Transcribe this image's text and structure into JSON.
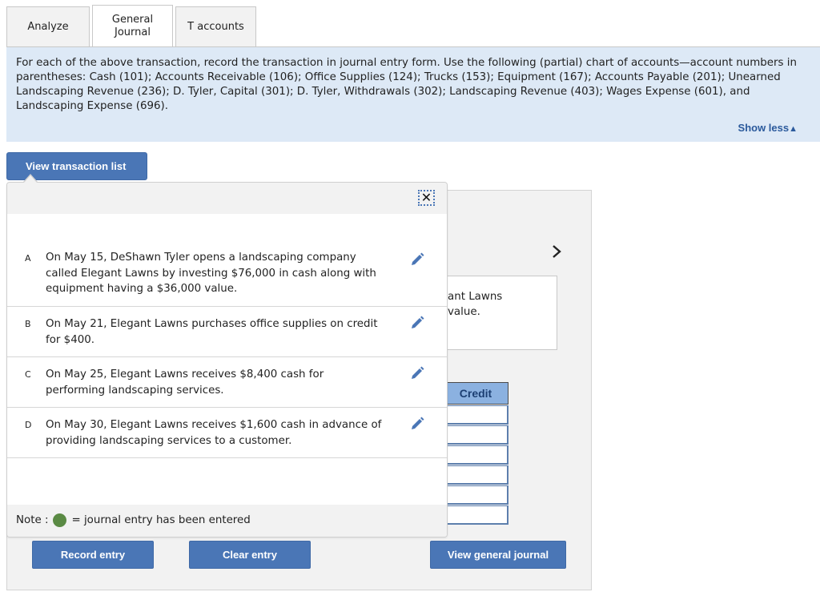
{
  "tabs": [
    {
      "label": "Analyze",
      "active": false
    },
    {
      "label_line1": "General",
      "label_line2": "Journal",
      "active": true
    },
    {
      "label": "T accounts",
      "active": false
    }
  ],
  "instructions": {
    "text": "For each of the above transaction, record the transaction in journal entry form. Use the following (partial) chart of accounts—account numbers in parentheses: Cash (101); Accounts Receivable (106); Office Supplies (124); Trucks (153); Equipment (167); Accounts Payable (201); Unearned Landscaping Revenue (236); D. Tyler, Capital (301); D. Tyler, Withdrawals (302); Landscaping Revenue (403); Wages Expense (601), and Landscaping Expense (696).",
    "toggle_label": "Show less",
    "toggle_icon": "triangle-up"
  },
  "view_transaction_list_label": "View transaction list",
  "popup": {
    "close_icon": "close",
    "transactions": [
      {
        "letter": "A",
        "text": "On May 15, DeShawn Tyler opens a landscaping company called Elegant Lawns by investing $76,000 in cash along with equipment having a $36,000 value.",
        "icon": "pencil-edit"
      },
      {
        "letter": "B",
        "text": "On May 21, Elegant Lawns purchases office supplies on credit for $400.",
        "icon": "pencil-edit"
      },
      {
        "letter": "C",
        "text": "On May 25, Elegant Lawns receives $8,400 cash for performing landscaping services.",
        "icon": "pencil-edit"
      },
      {
        "letter": "D",
        "text": "On May 30, Elegant Lawns receives $1,600 cash in advance of providing landscaping services to a customer.",
        "icon": "pencil-edit"
      }
    ],
    "note_prefix": "Note :",
    "note_suffix": "= journal entry has been entered",
    "note_dot_color": "#5a8a44"
  },
  "work_panel": {
    "next_icon": "chevron-right",
    "transaction_box_line1": "ant Lawns",
    "transaction_box_line2": "value.",
    "credit_header": "Credit",
    "credit_values": [
      "",
      "",
      "",
      "",
      "",
      ""
    ]
  },
  "buttons": {
    "record_entry": "Record entry",
    "clear_entry": "Clear entry",
    "view_general_journal": "View general journal"
  },
  "colors": {
    "accent_blue": "#4a76b6",
    "instructions_bg": "#dde9f6",
    "credit_header_bg": "#8bb1e0",
    "link_blue": "#2b5a9c"
  }
}
